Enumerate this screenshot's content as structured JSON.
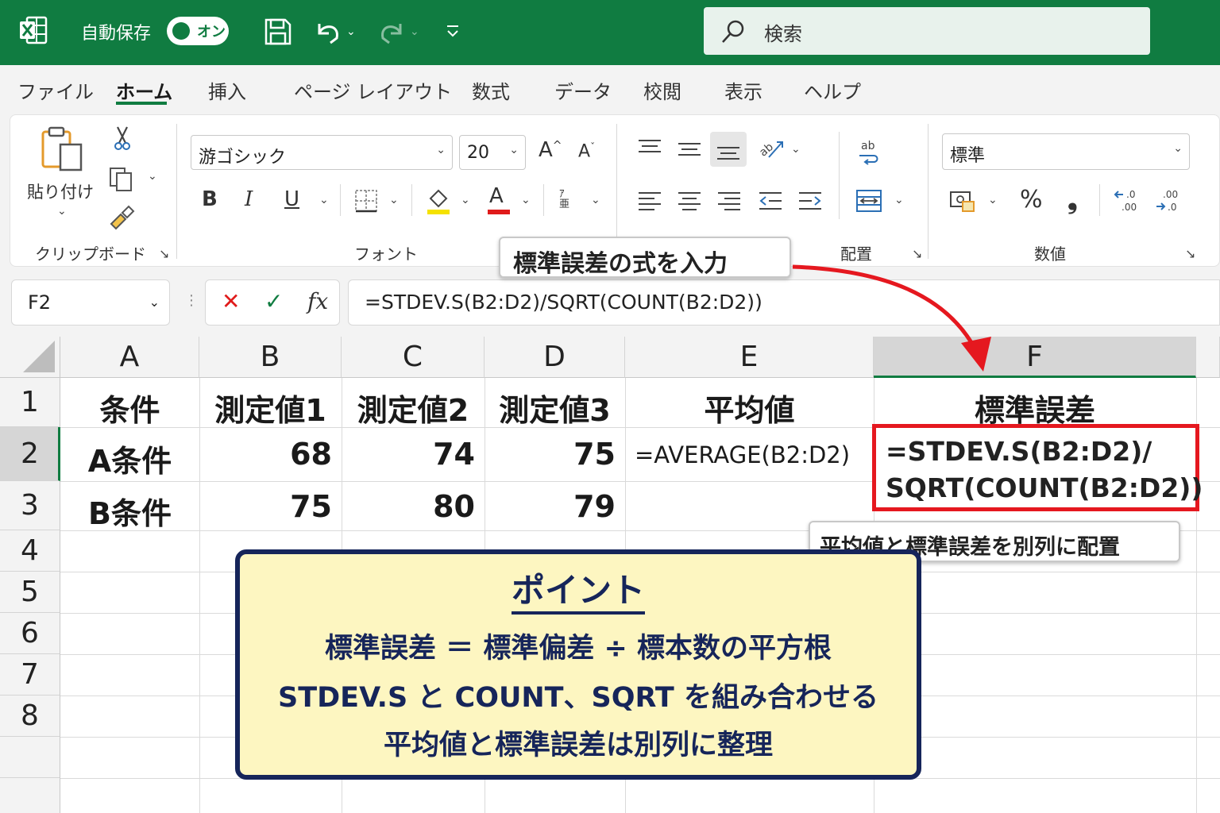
{
  "titlebar": {
    "autosave_label": "自動保存",
    "autosave_state": "オン",
    "search_placeholder": "検索"
  },
  "menu": {
    "tabs": [
      "ファイル",
      "ホーム",
      "挿入",
      "ページ レイアウト",
      "数式",
      "データ",
      "校閲",
      "表示",
      "ヘルプ"
    ],
    "active_tab": "ホーム"
  },
  "ribbon": {
    "paste_label": "貼り付け",
    "clipboard_group": "クリップボード",
    "font_name": "游ゴシック",
    "font_size": "20",
    "bold": "B",
    "italic": "I",
    "underline": "U",
    "font_color_letter": "A",
    "font_group": "フォント",
    "alignment_group": "配置",
    "number_format": "標準",
    "percent": "%",
    "comma": "❟",
    "number_group": "数値"
  },
  "formula_bar": {
    "name_box": "F2",
    "cancel_glyph": "✕",
    "enter_glyph": "✓",
    "fx_label": "fx",
    "formula": "=STDEV.S(B2:D2)/SQRT(COUNT(B2:D2))"
  },
  "sheet": {
    "columns": [
      "A",
      "B",
      "C",
      "D",
      "E",
      "F"
    ],
    "rows": [
      "1",
      "2",
      "3",
      "4",
      "5",
      "6",
      "7",
      "8"
    ],
    "header_row": [
      "条件",
      "測定値1",
      "測定値2",
      "測定値3",
      "平均値",
      "標準誤差"
    ],
    "row2": {
      "a": "A条件",
      "b": "68",
      "c": "74",
      "d": "75",
      "e": "=AVERAGE(B2:D2)",
      "f_line1": "=STDEV.S(B2:D2)/",
      "f_line2": "SQRT(COUNT(B2:D2))"
    },
    "row3": {
      "a": "B条件",
      "b": "75",
      "c": "80",
      "d": "79"
    }
  },
  "annotations": {
    "formula_callout": "標準誤差の式を入力",
    "layout_callout": "平均値と標準誤差を別列に配置"
  },
  "point_box": {
    "title": "ポイント",
    "lines": [
      "標準誤差 ＝ 標準偏差 ÷ 標本数の平方根",
      "STDEV.S と COUNT、SQRT を組み合わせる",
      "平均値と標準誤差は別列に整理"
    ]
  },
  "colors": {
    "excel_green": "#107c41",
    "highlight_red": "#e5181f",
    "point_navy": "#16255a",
    "point_yellow": "#fdf6c1"
  }
}
